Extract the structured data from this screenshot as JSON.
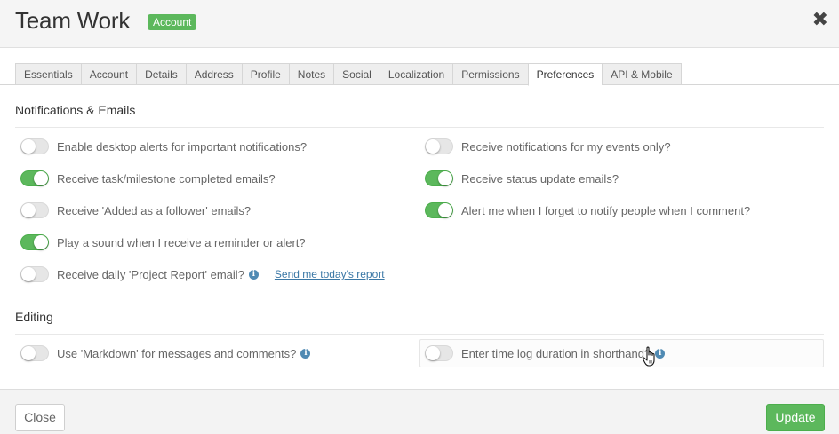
{
  "header": {
    "title": "Team Work",
    "badge": "Account",
    "close_glyph": "✖"
  },
  "tabs": [
    {
      "label": "Essentials",
      "active": false
    },
    {
      "label": "Account",
      "active": false
    },
    {
      "label": "Details",
      "active": false
    },
    {
      "label": "Address",
      "active": false
    },
    {
      "label": "Profile",
      "active": false
    },
    {
      "label": "Notes",
      "active": false
    },
    {
      "label": "Social",
      "active": false
    },
    {
      "label": "Localization",
      "active": false
    },
    {
      "label": "Permissions",
      "active": false
    },
    {
      "label": "Preferences",
      "active": true
    },
    {
      "label": "API & Mobile",
      "active": false
    }
  ],
  "notifications": {
    "title": "Notifications & Emails",
    "left": [
      {
        "label": "Enable desktop alerts for important notifications?",
        "on": false
      },
      {
        "label": "Receive task/milestone completed emails?",
        "on": true
      },
      {
        "label": "Receive 'Added as a follower' emails?",
        "on": false
      },
      {
        "label": "Play a sound when I receive a reminder or alert?",
        "on": true
      },
      {
        "label": "Receive daily 'Project Report' email?",
        "on": false,
        "info": true,
        "link": "Send me today's report"
      }
    ],
    "right": [
      {
        "label": "Receive notifications for my events only?",
        "on": false
      },
      {
        "label": "Receive status update emails?",
        "on": true
      },
      {
        "label": "Alert me when I forget to notify people when I comment?",
        "on": true
      }
    ]
  },
  "editing": {
    "title": "Editing",
    "left": {
      "label": "Use 'Markdown' for messages and comments?",
      "on": false,
      "info": true
    },
    "right": {
      "label": "Enter time log duration in shorthand?",
      "on": false,
      "info": true
    }
  },
  "footer": {
    "close_label": "Close",
    "update_label": "Update"
  },
  "colors": {
    "accent_green": "#5cb85c",
    "link_blue": "#3b78a6",
    "info_blue": "#4f8ab3"
  }
}
